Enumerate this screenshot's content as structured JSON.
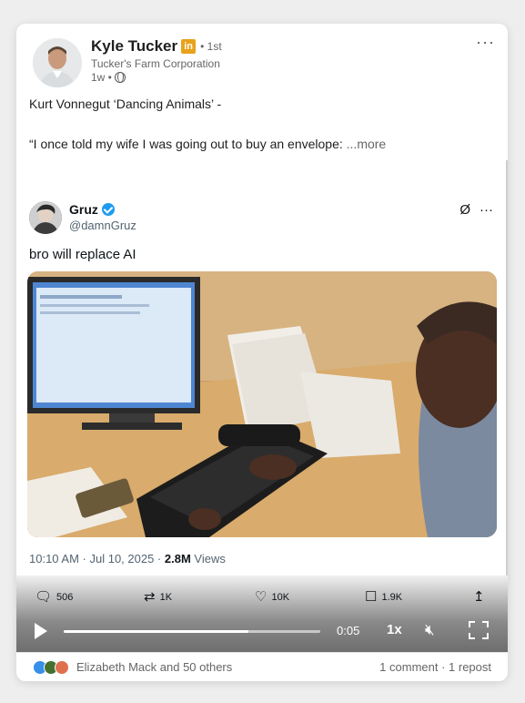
{
  "post": {
    "author_name": "Kyle Tucker",
    "author_badge": "in",
    "degree": "• 1st",
    "company": "Tucker's Farm Corporation",
    "time": "1w •",
    "line1": "Kurt Vonnegut ‘Dancing Animals’ -",
    "line2": "“I once told my wife I was going out to buy an envelope:",
    "more": "...more",
    "menu_icon": "more-horizontal-icon"
  },
  "tweet": {
    "name": "Gruz",
    "handle": "@damnGruz",
    "text": "bro will replace AI",
    "meta_time": "10:10 AM · Jul 10, 2025 · ",
    "views_count": "2.8M",
    "views_label": " Views",
    "icons": {
      "grok": "Ø",
      "more": "···"
    }
  },
  "stats": {
    "replies": "506",
    "reposts": "1K",
    "likes": "10K",
    "bookmarks": "1.9K"
  },
  "player": {
    "time": "0:05",
    "speed": "1x",
    "progress": 0.72
  },
  "footer": {
    "reactions_text": "Elizabeth Mack and 50 others",
    "counts": "1 comment · 1 repost"
  },
  "colors": {
    "linkedin_badge": "#e8a21c",
    "verified": "#1d9bf0",
    "like_reaction": "#378fe9",
    "celebrate_reaction": "#44712e",
    "love_reaction": "#df704d"
  }
}
